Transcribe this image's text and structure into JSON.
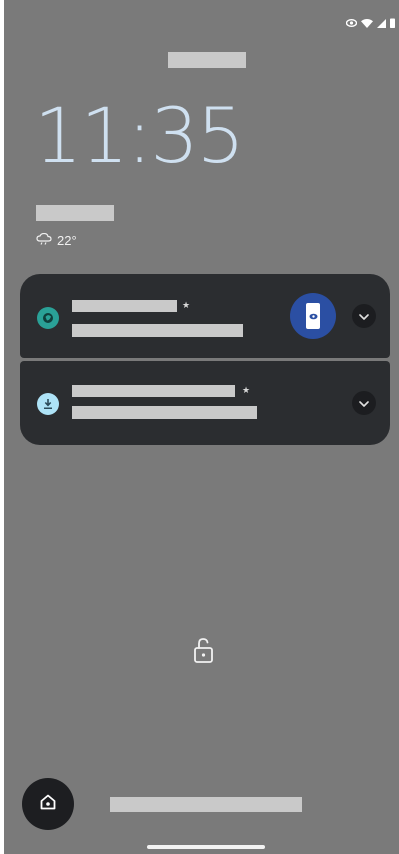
{
  "status_bar": {
    "icons": [
      "eye-icon",
      "wifi-icon",
      "cell-signal-icon",
      "battery-icon"
    ]
  },
  "lockscreen": {
    "time": "11:35",
    "weather": {
      "icon": "cloud-rain-icon",
      "temperature": "22°"
    }
  },
  "notifications": [
    {
      "app_icon": "app-circle-icon",
      "app_icon_color": "#2aa197",
      "star": "★",
      "has_thumbnail": true,
      "thumbnail_color": "#2b4fa3",
      "expand_icon": "chevron-down-icon"
    },
    {
      "app_icon": "download-icon",
      "app_icon_color": "#aee3f7",
      "star": "★",
      "has_thumbnail": false,
      "expand_icon": "chevron-down-icon"
    }
  ],
  "bottom": {
    "lock_icon": "unlock-icon",
    "home_icon": "home-icon"
  },
  "colors": {
    "background": "#7a7a7a",
    "card": "#2b2d30",
    "clock": "#cfe0f0",
    "redaction": "#c9c9c9"
  }
}
